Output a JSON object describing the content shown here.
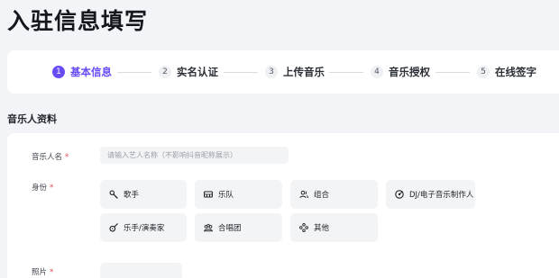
{
  "page": {
    "title": "入驻信息填写"
  },
  "steps": [
    {
      "num": "1",
      "label": "基本信息",
      "active": true
    },
    {
      "num": "2",
      "label": "实名认证",
      "active": false
    },
    {
      "num": "3",
      "label": "上传音乐",
      "active": false
    },
    {
      "num": "4",
      "label": "音乐授权",
      "active": false
    },
    {
      "num": "5",
      "label": "在线签字",
      "active": false
    }
  ],
  "section": {
    "title": "音乐人资料"
  },
  "form": {
    "name_label": "音乐人名",
    "name_placeholder": "请输入艺人名称（不影响抖音昵称展示）",
    "name_value": "",
    "identity_label": "身份",
    "photo_label": "照片",
    "required_mark": "*"
  },
  "identity_options": [
    {
      "label": "歌手",
      "icon": "microphone-icon"
    },
    {
      "label": "乐队",
      "icon": "keyboard-icon"
    },
    {
      "label": "组合",
      "icon": "group-icon"
    },
    {
      "label": "DJ/电子音乐制作人",
      "icon": "vinyl-disc-icon"
    },
    {
      "label": "乐手/演奏家",
      "icon": "guitar-icon"
    },
    {
      "label": "合唱团",
      "icon": "choir-icon"
    },
    {
      "label": "其他",
      "icon": "more-icon"
    }
  ],
  "colors": {
    "accent": "#6a4cf5",
    "required": "#e5484d",
    "background": "#f3f4f7",
    "card": "#ffffff",
    "field_bg": "#f3f4f6"
  }
}
